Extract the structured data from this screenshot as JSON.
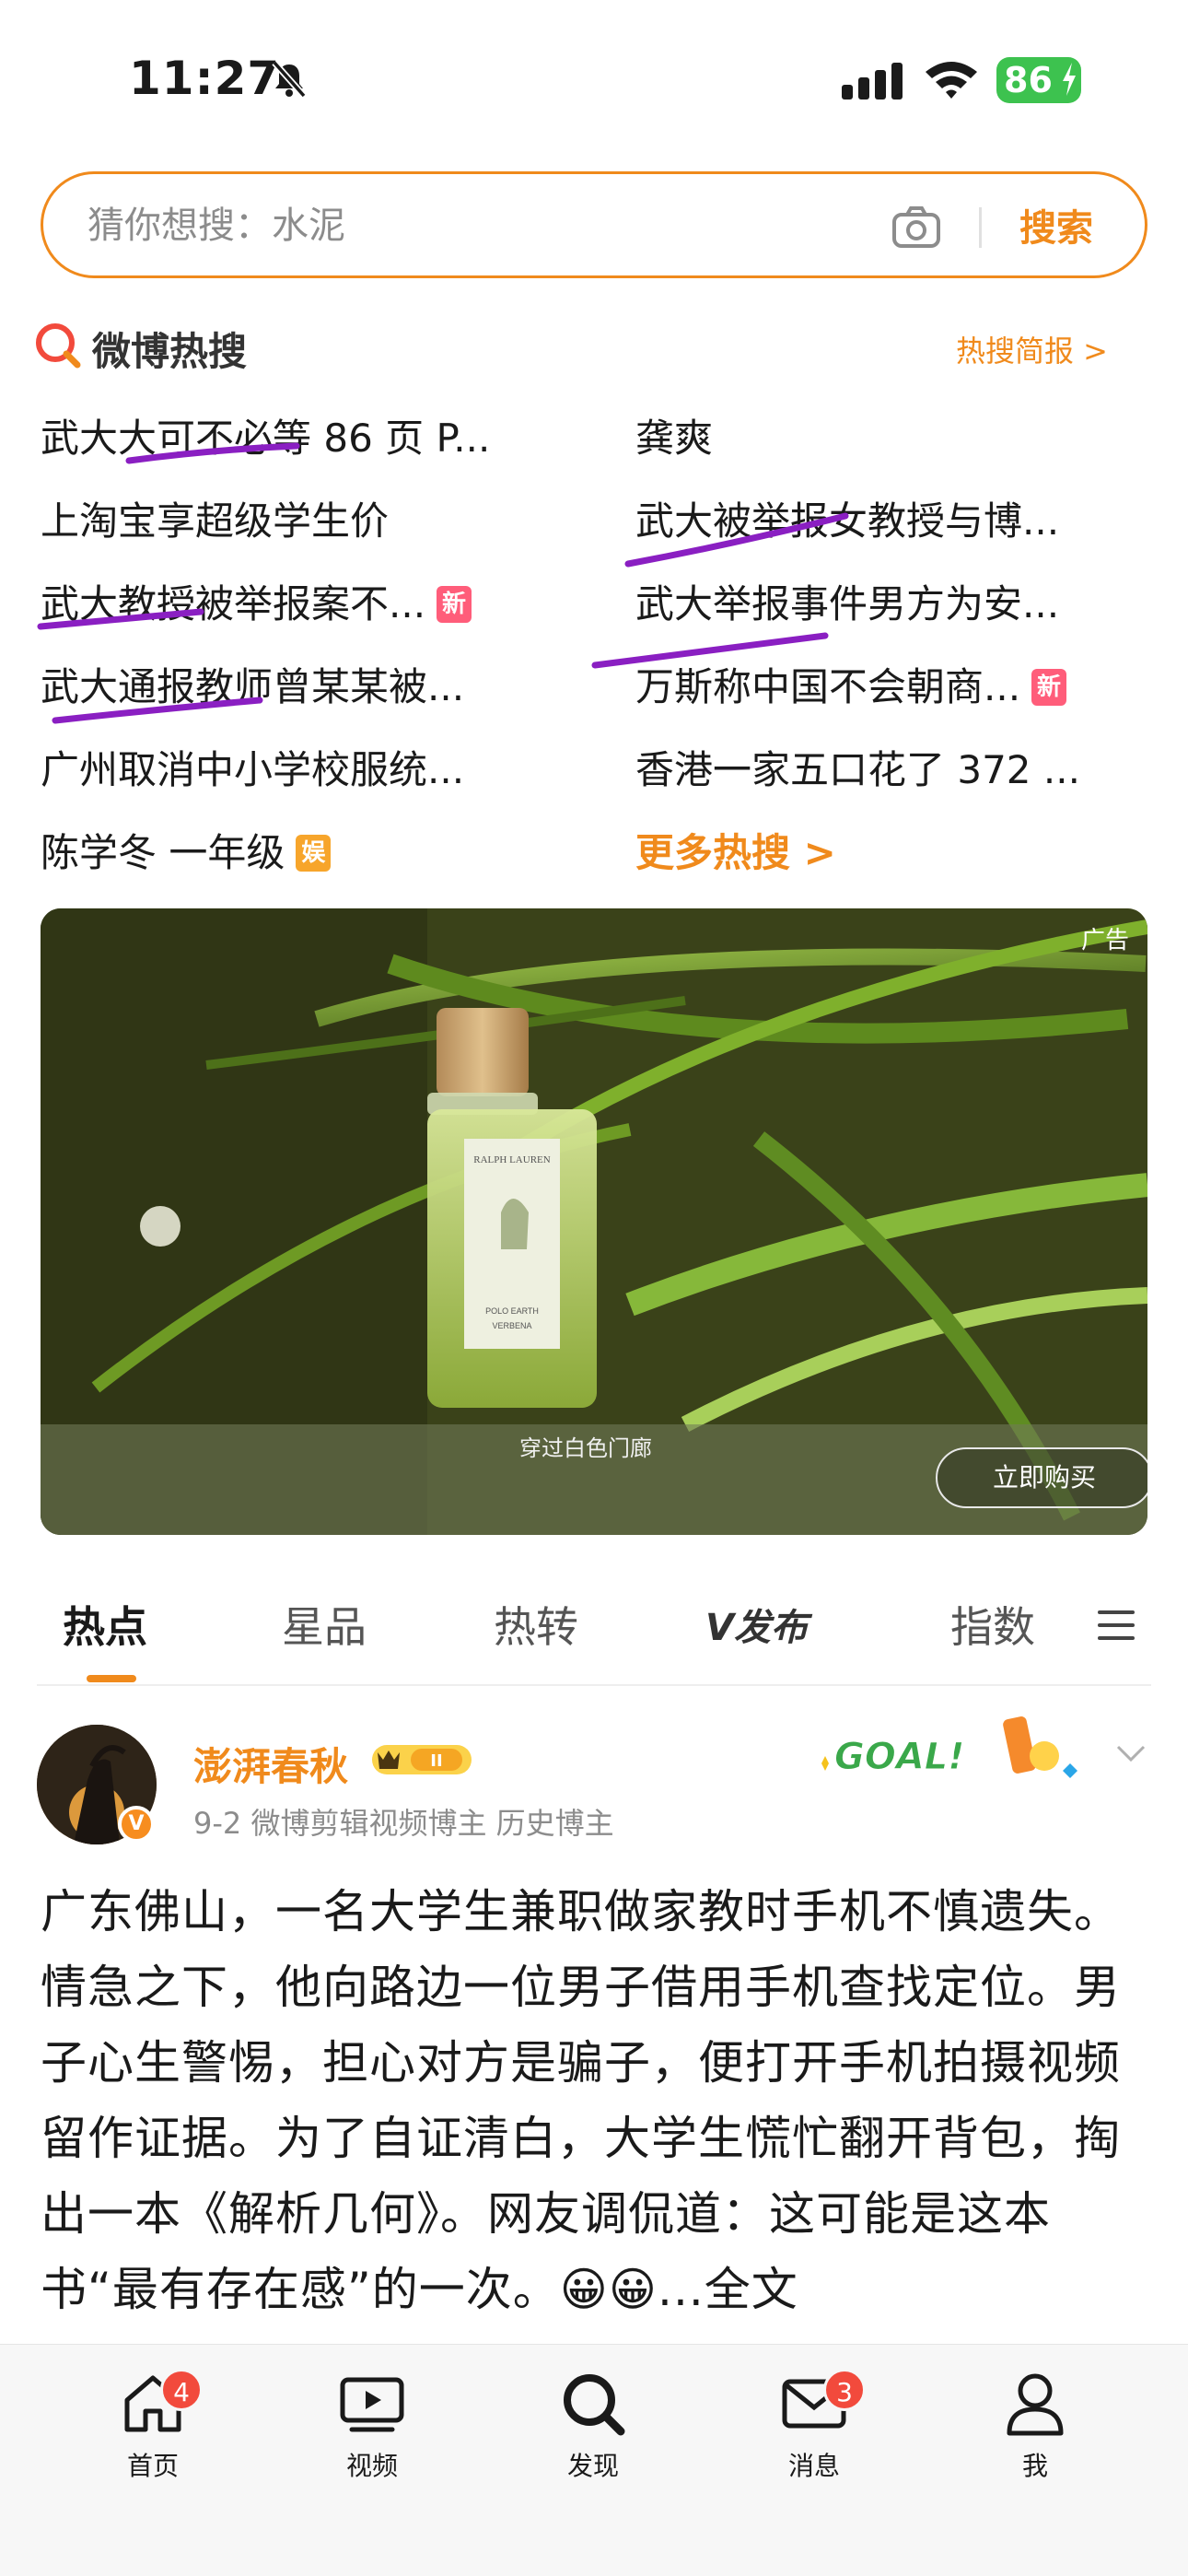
{
  "status_bar": {
    "time": "11:27",
    "battery": "86"
  },
  "search": {
    "placeholder": "猜你想搜：水泥",
    "button_label": "搜索"
  },
  "hot_search": {
    "title": "微博热搜",
    "brief_link": "热搜简报 >",
    "items": [
      {
        "text": "武大大可不必等 86 页 P...",
        "badge": ""
      },
      {
        "text": "龚爽",
        "badge": ""
      },
      {
        "text": "上淘宝享超级学生价",
        "badge": ""
      },
      {
        "text": "武大被举报女教授与博...",
        "badge": ""
      },
      {
        "text": "武大教授被举报案不...",
        "badge": "新"
      },
      {
        "text": "武大举报事件男方为安...",
        "badge": ""
      },
      {
        "text": "武大通报教师曾某某被...",
        "badge": ""
      },
      {
        "text": "万斯称中国不会朝商...",
        "badge": "新"
      },
      {
        "text": "广州取消中小学校服统...",
        "badge": ""
      },
      {
        "text": "香港一家五口花了 372 ...",
        "badge": ""
      },
      {
        "text": "陈学冬 一年级",
        "badge": "娱"
      }
    ],
    "more_label": "更多热搜 >"
  },
  "ad": {
    "tag": "广告",
    "caption": "穿过白色门廊",
    "cta": "立即购买",
    "bottle_brand": "RALPH LAUREN",
    "bottle_line1": "POLO EARTH",
    "bottle_line2": "VERBENA"
  },
  "tabs": [
    "热点",
    "星品",
    "热转",
    "发布",
    "指数"
  ],
  "tab_v_prefix": "V",
  "post": {
    "author": "澎湃春秋",
    "level": "II",
    "avatar_badge": "V",
    "meta": "9-2  微博剪辑视频博主 历史博主",
    "goal_label": "GOAL!",
    "text": "广东佛山，一名大学生兼职做家教时手机不慎遗失。情急之下，他向路边一位男子借用手机查找定位。男子心生警惕，担心对方是骗子，便打开手机拍摄视频留作证据。为了自证清白，大学生慌忙翻开背包，掏出一本《解析几何》。网友调侃道：这可能是这本书“最有存在感”的一次。😀😀...全文"
  },
  "bottom_nav": [
    {
      "label": "首页",
      "badge": "4",
      "icon": "home-icon"
    },
    {
      "label": "视频",
      "badge": "",
      "icon": "video-icon"
    },
    {
      "label": "发现",
      "badge": "",
      "icon": "discover-icon"
    },
    {
      "label": "消息",
      "badge": "3",
      "icon": "message-icon"
    },
    {
      "label": "我",
      "badge": "",
      "icon": "profile-icon"
    }
  ],
  "colors": {
    "accent": "#f08a1c",
    "new_badge": "#ff5d7a",
    "ent_badge": "#f7a52b",
    "marker": "#8a1fc2",
    "nav_badge": "#f24a3c"
  }
}
